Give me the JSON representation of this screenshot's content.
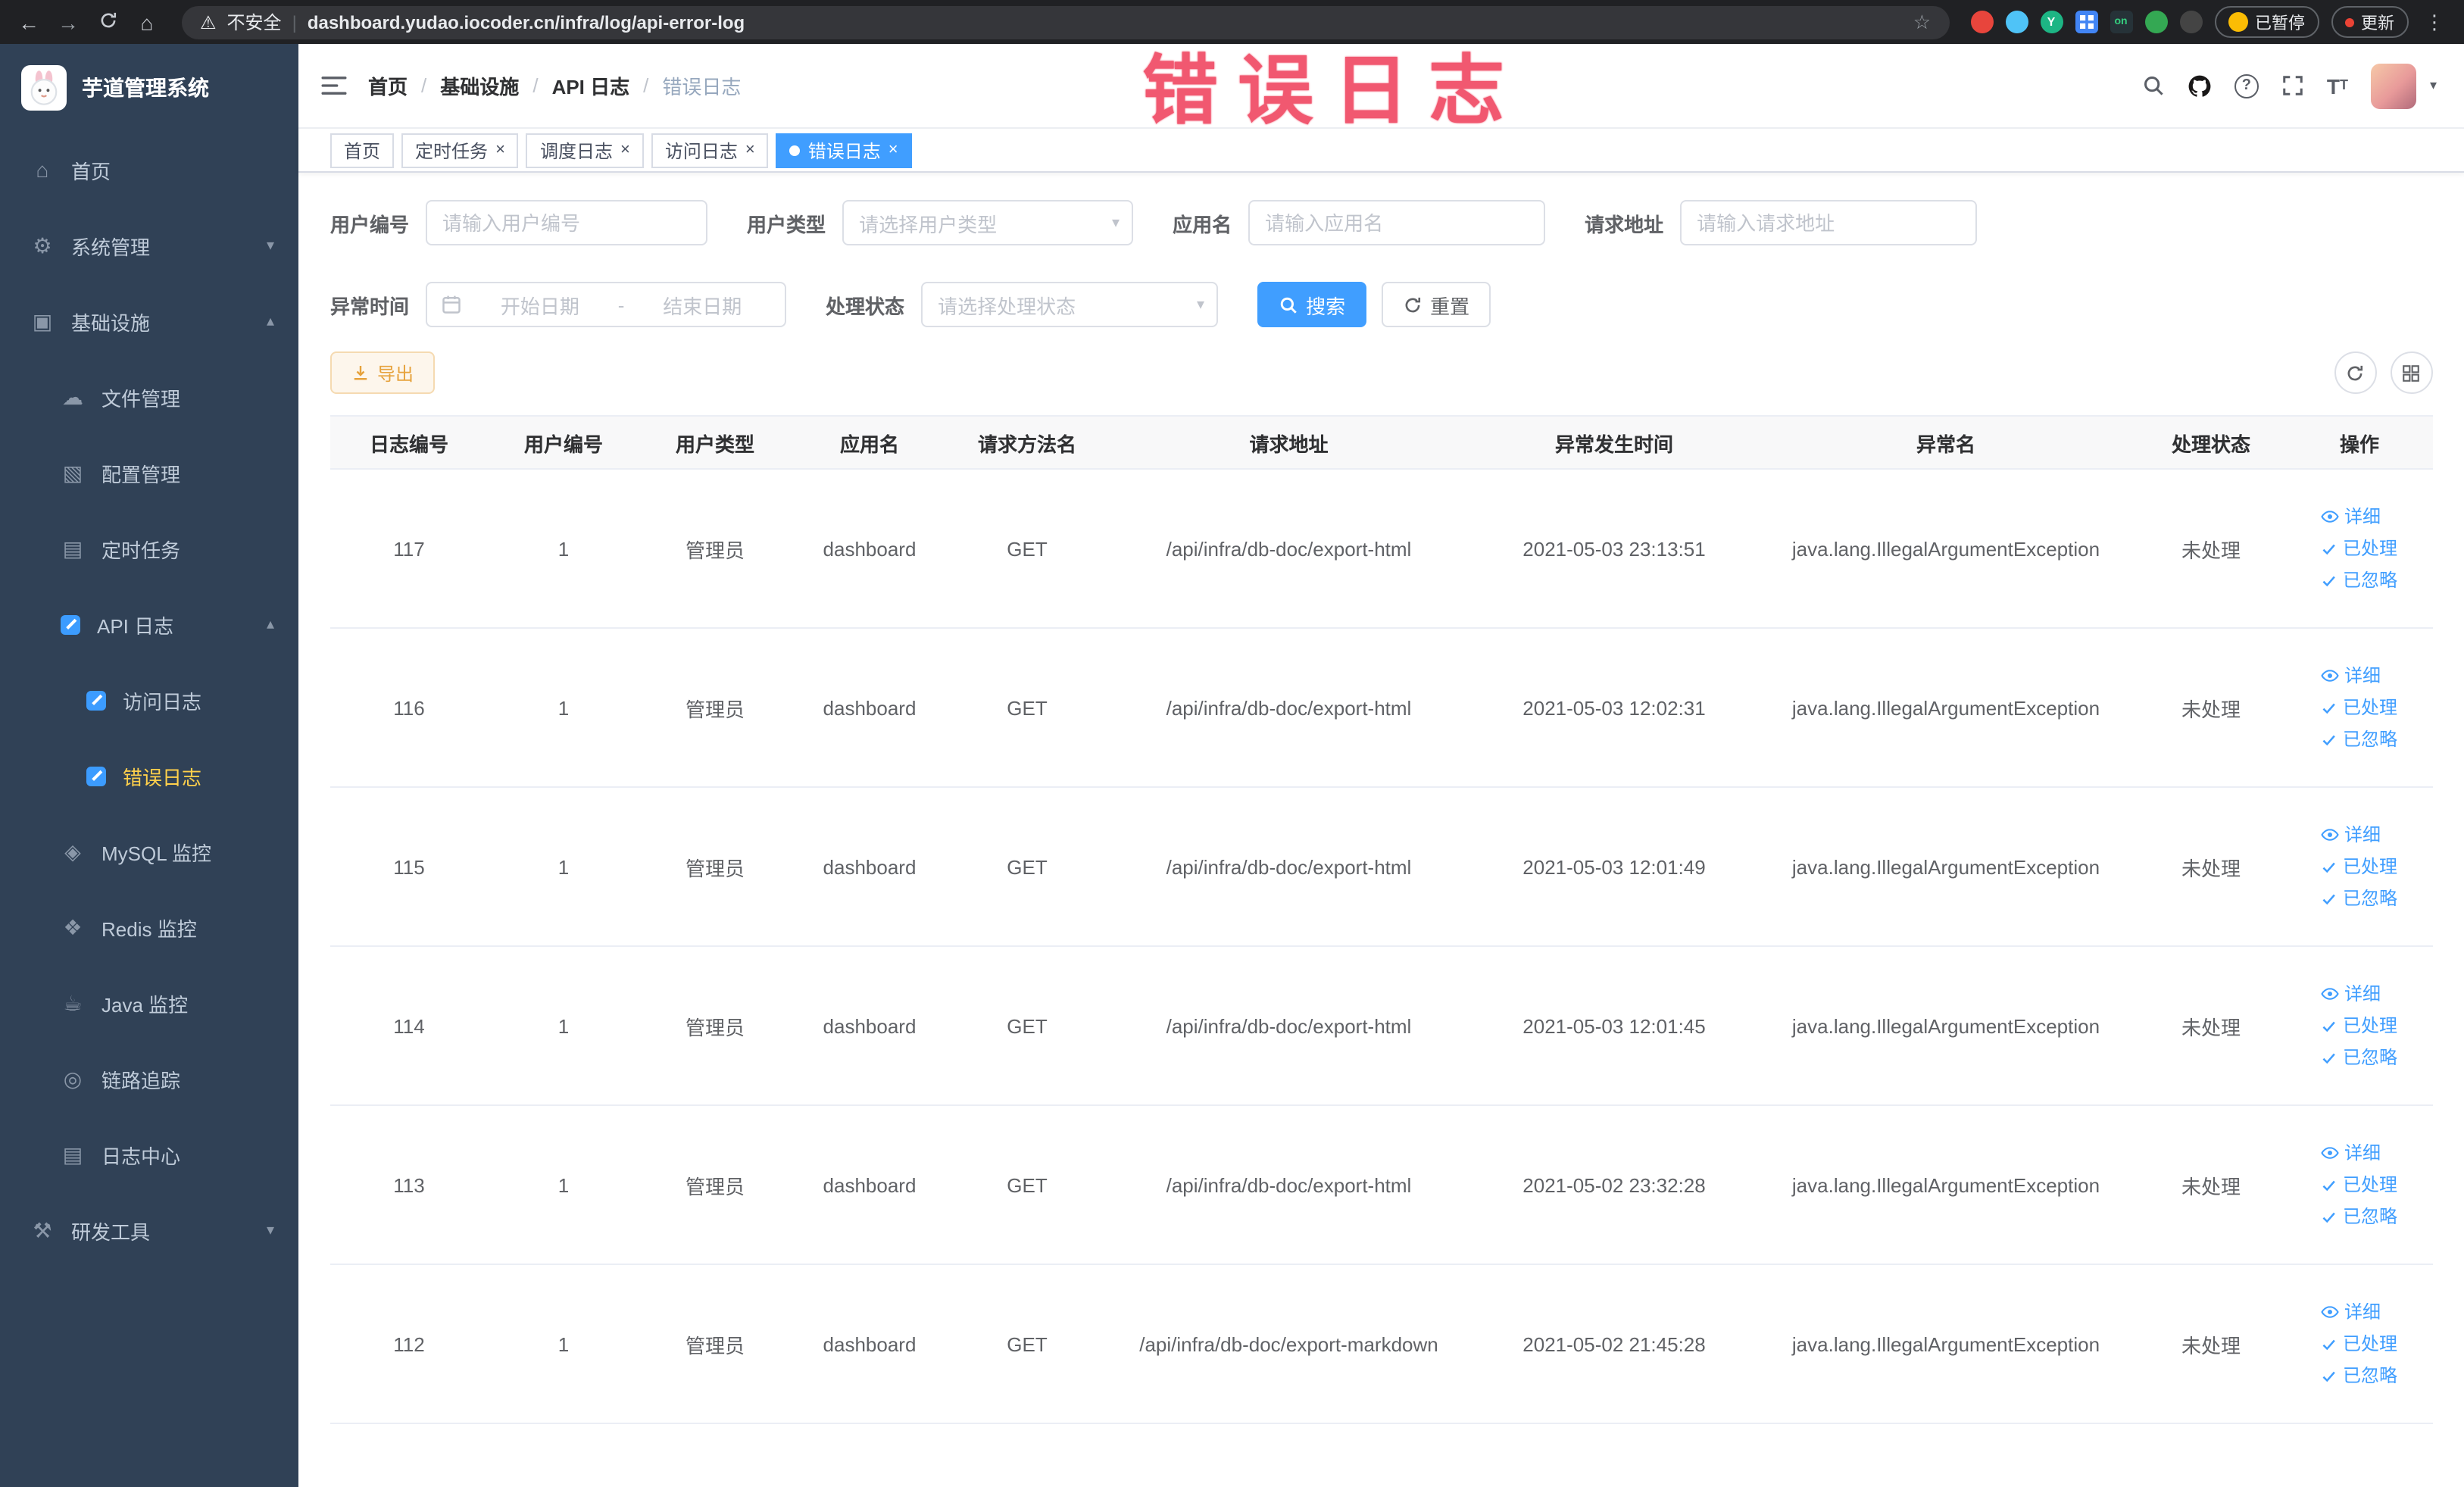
{
  "browser": {
    "security_label": "不安全",
    "url": "dashboard.yudao.iocoder.cn/infra/log/api-error-log",
    "extension_on_label": "on",
    "paused_label": "已暂停",
    "update_label": "更新"
  },
  "sidebar": {
    "logo_title": "芋道管理系统",
    "items": [
      {
        "label": "首页"
      },
      {
        "label": "系统管理"
      },
      {
        "label": "基础设施"
      },
      {
        "label": "文件管理"
      },
      {
        "label": "配置管理"
      },
      {
        "label": "定时任务"
      },
      {
        "label": "API 日志"
      },
      {
        "label": "访问日志"
      },
      {
        "label": "错误日志"
      },
      {
        "label": "MySQL 监控"
      },
      {
        "label": "Redis 监控"
      },
      {
        "label": "Java 监控"
      },
      {
        "label": "链路追踪"
      },
      {
        "label": "日志中心"
      },
      {
        "label": "研发工具"
      }
    ]
  },
  "header": {
    "breadcrumb": [
      "首页",
      "基础设施",
      "API 日志",
      "错误日志"
    ],
    "watermark": "错误日志"
  },
  "tabs": [
    {
      "label": "首页"
    },
    {
      "label": "定时任务"
    },
    {
      "label": "调度日志"
    },
    {
      "label": "访问日志"
    },
    {
      "label": "错误日志"
    }
  ],
  "filters": {
    "user_id_label": "用户编号",
    "user_id_placeholder": "请输入用户编号",
    "user_type_label": "用户类型",
    "user_type_placeholder": "请选择用户类型",
    "app_name_label": "应用名",
    "app_name_placeholder": "请输入应用名",
    "request_url_label": "请求地址",
    "request_url_placeholder": "请输入请求地址",
    "exception_time_label": "异常时间",
    "date_start_placeholder": "开始日期",
    "date_separator": "-",
    "date_end_placeholder": "结束日期",
    "status_label": "处理状态",
    "status_placeholder": "请选择处理状态",
    "search_label": "搜索",
    "reset_label": "重置"
  },
  "toolbar": {
    "export_label": "导出"
  },
  "table": {
    "columns": [
      "日志编号",
      "用户编号",
      "用户类型",
      "应用名",
      "请求方法名",
      "请求地址",
      "异常发生时间",
      "异常名",
      "处理状态",
      "操作"
    ],
    "actions": [
      "详细",
      "已处理",
      "已忽略"
    ],
    "rows": [
      {
        "id": "117",
        "user_id": "1",
        "user_type": "管理员",
        "app": "dashboard",
        "method": "GET",
        "url": "/api/infra/db-doc/export-html",
        "time": "2021-05-03 23:13:51",
        "exception": "java.lang.IllegalArgumentException",
        "status": "未处理"
      },
      {
        "id": "116",
        "user_id": "1",
        "user_type": "管理员",
        "app": "dashboard",
        "method": "GET",
        "url": "/api/infra/db-doc/export-html",
        "time": "2021-05-03 12:02:31",
        "exception": "java.lang.IllegalArgumentException",
        "status": "未处理"
      },
      {
        "id": "115",
        "user_id": "1",
        "user_type": "管理员",
        "app": "dashboard",
        "method": "GET",
        "url": "/api/infra/db-doc/export-html",
        "time": "2021-05-03 12:01:49",
        "exception": "java.lang.IllegalArgumentException",
        "status": "未处理"
      },
      {
        "id": "114",
        "user_id": "1",
        "user_type": "管理员",
        "app": "dashboard",
        "method": "GET",
        "url": "/api/infra/db-doc/export-html",
        "time": "2021-05-03 12:01:45",
        "exception": "java.lang.IllegalArgumentException",
        "status": "未处理"
      },
      {
        "id": "113",
        "user_id": "1",
        "user_type": "管理员",
        "app": "dashboard",
        "method": "GET",
        "url": "/api/infra/db-doc/export-html",
        "time": "2021-05-02 23:32:28",
        "exception": "java.lang.IllegalArgumentException",
        "status": "未处理"
      },
      {
        "id": "112",
        "user_id": "1",
        "user_type": "管理员",
        "app": "dashboard",
        "method": "GET",
        "url": "/api/infra/db-doc/export-markdown",
        "time": "2021-05-02 21:45:28",
        "exception": "java.lang.IllegalArgumentException",
        "status": "未处理"
      }
    ]
  },
  "colors": {
    "primary": "#409eff",
    "warning": "#e6a23c",
    "sidebar_bg": "#304156",
    "active_menu_text": "#ffd04b",
    "watermark": "#f04c66"
  }
}
